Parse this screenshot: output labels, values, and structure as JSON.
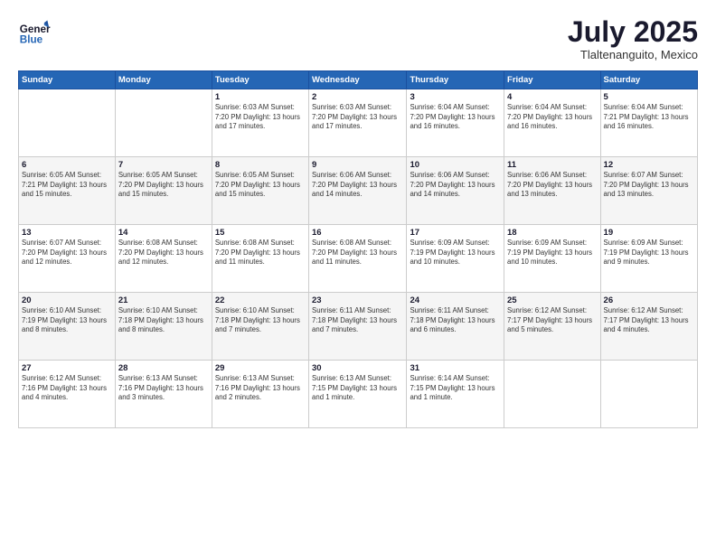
{
  "header": {
    "logo_line1": "General",
    "logo_line2": "Blue",
    "month": "July 2025",
    "location": "Tlaltenanguito, Mexico"
  },
  "days_of_week": [
    "Sunday",
    "Monday",
    "Tuesday",
    "Wednesday",
    "Thursday",
    "Friday",
    "Saturday"
  ],
  "weeks": [
    [
      {
        "day": "",
        "info": ""
      },
      {
        "day": "",
        "info": ""
      },
      {
        "day": "1",
        "info": "Sunrise: 6:03 AM\nSunset: 7:20 PM\nDaylight: 13 hours\nand 17 minutes."
      },
      {
        "day": "2",
        "info": "Sunrise: 6:03 AM\nSunset: 7:20 PM\nDaylight: 13 hours\nand 17 minutes."
      },
      {
        "day": "3",
        "info": "Sunrise: 6:04 AM\nSunset: 7:20 PM\nDaylight: 13 hours\nand 16 minutes."
      },
      {
        "day": "4",
        "info": "Sunrise: 6:04 AM\nSunset: 7:20 PM\nDaylight: 13 hours\nand 16 minutes."
      },
      {
        "day": "5",
        "info": "Sunrise: 6:04 AM\nSunset: 7:21 PM\nDaylight: 13 hours\nand 16 minutes."
      }
    ],
    [
      {
        "day": "6",
        "info": "Sunrise: 6:05 AM\nSunset: 7:21 PM\nDaylight: 13 hours\nand 15 minutes."
      },
      {
        "day": "7",
        "info": "Sunrise: 6:05 AM\nSunset: 7:20 PM\nDaylight: 13 hours\nand 15 minutes."
      },
      {
        "day": "8",
        "info": "Sunrise: 6:05 AM\nSunset: 7:20 PM\nDaylight: 13 hours\nand 15 minutes."
      },
      {
        "day": "9",
        "info": "Sunrise: 6:06 AM\nSunset: 7:20 PM\nDaylight: 13 hours\nand 14 minutes."
      },
      {
        "day": "10",
        "info": "Sunrise: 6:06 AM\nSunset: 7:20 PM\nDaylight: 13 hours\nand 14 minutes."
      },
      {
        "day": "11",
        "info": "Sunrise: 6:06 AM\nSunset: 7:20 PM\nDaylight: 13 hours\nand 13 minutes."
      },
      {
        "day": "12",
        "info": "Sunrise: 6:07 AM\nSunset: 7:20 PM\nDaylight: 13 hours\nand 13 minutes."
      }
    ],
    [
      {
        "day": "13",
        "info": "Sunrise: 6:07 AM\nSunset: 7:20 PM\nDaylight: 13 hours\nand 12 minutes."
      },
      {
        "day": "14",
        "info": "Sunrise: 6:08 AM\nSunset: 7:20 PM\nDaylight: 13 hours\nand 12 minutes."
      },
      {
        "day": "15",
        "info": "Sunrise: 6:08 AM\nSunset: 7:20 PM\nDaylight: 13 hours\nand 11 minutes."
      },
      {
        "day": "16",
        "info": "Sunrise: 6:08 AM\nSunset: 7:20 PM\nDaylight: 13 hours\nand 11 minutes."
      },
      {
        "day": "17",
        "info": "Sunrise: 6:09 AM\nSunset: 7:19 PM\nDaylight: 13 hours\nand 10 minutes."
      },
      {
        "day": "18",
        "info": "Sunrise: 6:09 AM\nSunset: 7:19 PM\nDaylight: 13 hours\nand 10 minutes."
      },
      {
        "day": "19",
        "info": "Sunrise: 6:09 AM\nSunset: 7:19 PM\nDaylight: 13 hours\nand 9 minutes."
      }
    ],
    [
      {
        "day": "20",
        "info": "Sunrise: 6:10 AM\nSunset: 7:19 PM\nDaylight: 13 hours\nand 8 minutes."
      },
      {
        "day": "21",
        "info": "Sunrise: 6:10 AM\nSunset: 7:18 PM\nDaylight: 13 hours\nand 8 minutes."
      },
      {
        "day": "22",
        "info": "Sunrise: 6:10 AM\nSunset: 7:18 PM\nDaylight: 13 hours\nand 7 minutes."
      },
      {
        "day": "23",
        "info": "Sunrise: 6:11 AM\nSunset: 7:18 PM\nDaylight: 13 hours\nand 7 minutes."
      },
      {
        "day": "24",
        "info": "Sunrise: 6:11 AM\nSunset: 7:18 PM\nDaylight: 13 hours\nand 6 minutes."
      },
      {
        "day": "25",
        "info": "Sunrise: 6:12 AM\nSunset: 7:17 PM\nDaylight: 13 hours\nand 5 minutes."
      },
      {
        "day": "26",
        "info": "Sunrise: 6:12 AM\nSunset: 7:17 PM\nDaylight: 13 hours\nand 4 minutes."
      }
    ],
    [
      {
        "day": "27",
        "info": "Sunrise: 6:12 AM\nSunset: 7:16 PM\nDaylight: 13 hours\nand 4 minutes."
      },
      {
        "day": "28",
        "info": "Sunrise: 6:13 AM\nSunset: 7:16 PM\nDaylight: 13 hours\nand 3 minutes."
      },
      {
        "day": "29",
        "info": "Sunrise: 6:13 AM\nSunset: 7:16 PM\nDaylight: 13 hours\nand 2 minutes."
      },
      {
        "day": "30",
        "info": "Sunrise: 6:13 AM\nSunset: 7:15 PM\nDaylight: 13 hours\nand 1 minute."
      },
      {
        "day": "31",
        "info": "Sunrise: 6:14 AM\nSunset: 7:15 PM\nDaylight: 13 hours\nand 1 minute."
      },
      {
        "day": "",
        "info": ""
      },
      {
        "day": "",
        "info": ""
      }
    ]
  ]
}
